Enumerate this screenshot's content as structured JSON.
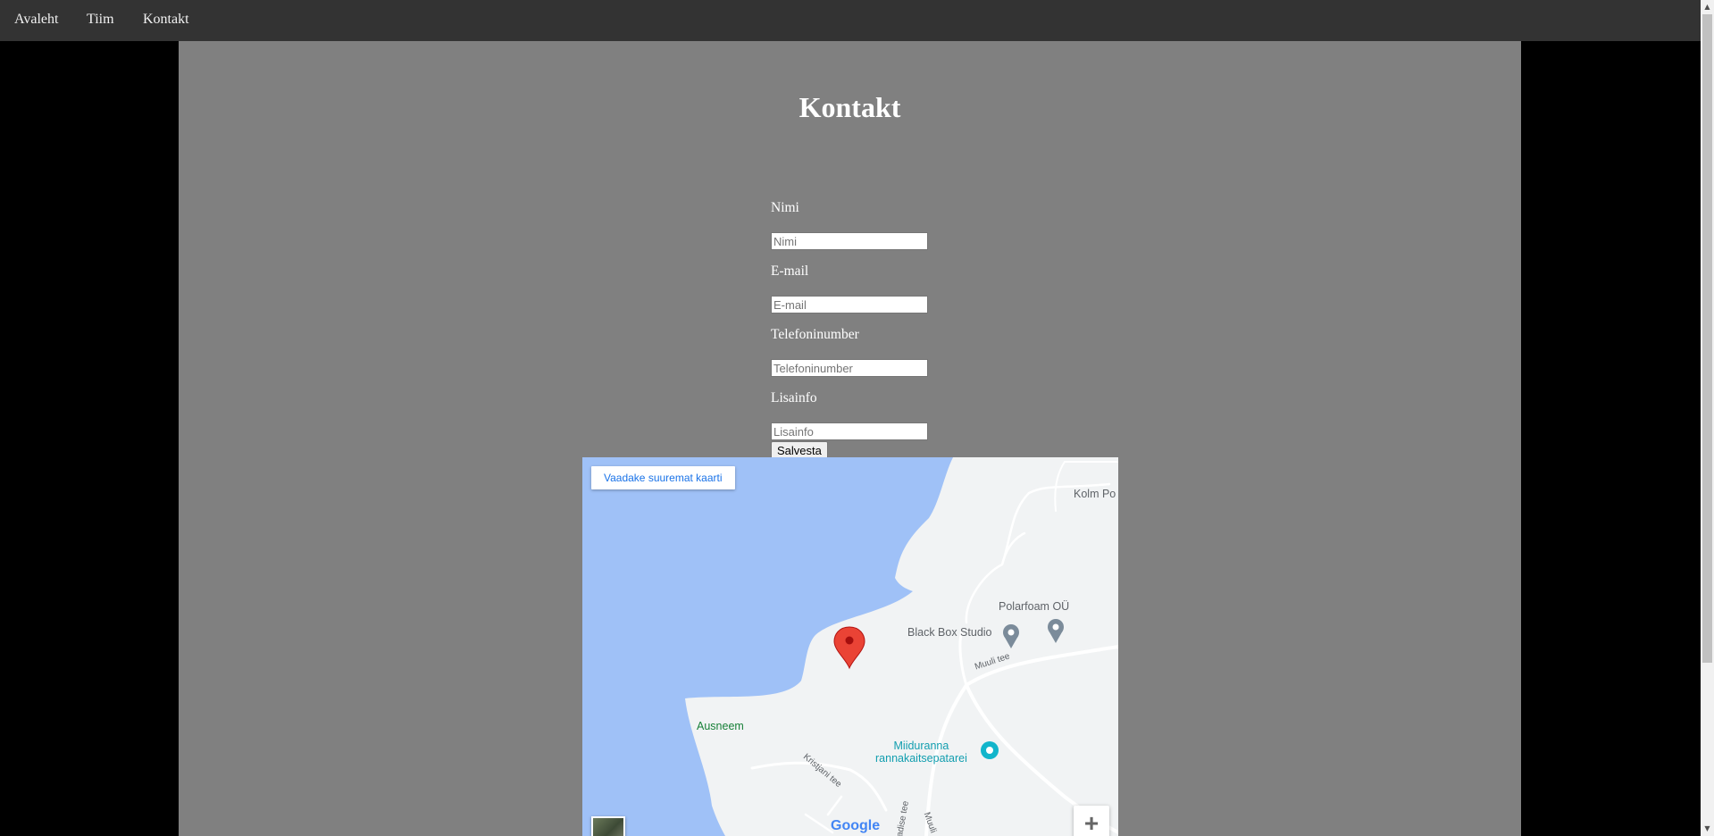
{
  "nav": {
    "items": [
      "Avaleht",
      "Tiim",
      "Kontakt"
    ]
  },
  "page": {
    "title": "Kontakt"
  },
  "form": {
    "name_label": "Nimi",
    "name_placeholder": "Nimi",
    "email_label": "E-mail",
    "email_placeholder": "E-mail",
    "phone_label": "Telefoninumber",
    "phone_placeholder": "Telefoninumber",
    "info_label": "Lisainfo",
    "info_placeholder": "Lisainfo",
    "submit_label": "Salvesta"
  },
  "map": {
    "larger_map_link": "Vaadake suuremat kaarti",
    "places": {
      "kolm": "Kolm Po",
      "polarfoam": "Polarfoam OÜ",
      "blackbox": "Black Box Studio",
      "ausneem": "Ausneem",
      "miiduranna_1": "Miiduranna",
      "miiduranna_2": "rannakaitsepatarei"
    },
    "roads": {
      "muuli_1": "Muuli tee",
      "kristjani": "Kristjani tee",
      "muuli_2": "Muuli",
      "paradise": "adise tee"
    },
    "zoom_in": "+",
    "zoom_out": "−",
    "logo": "Google",
    "colors": {
      "water": "#9fc1f7",
      "land": "#f1f3f4",
      "road": "#ffffff",
      "pin": "#ea4335",
      "park_label": "#188038",
      "poi_label": "#5f6368",
      "attraction": "#12b5cb"
    }
  }
}
